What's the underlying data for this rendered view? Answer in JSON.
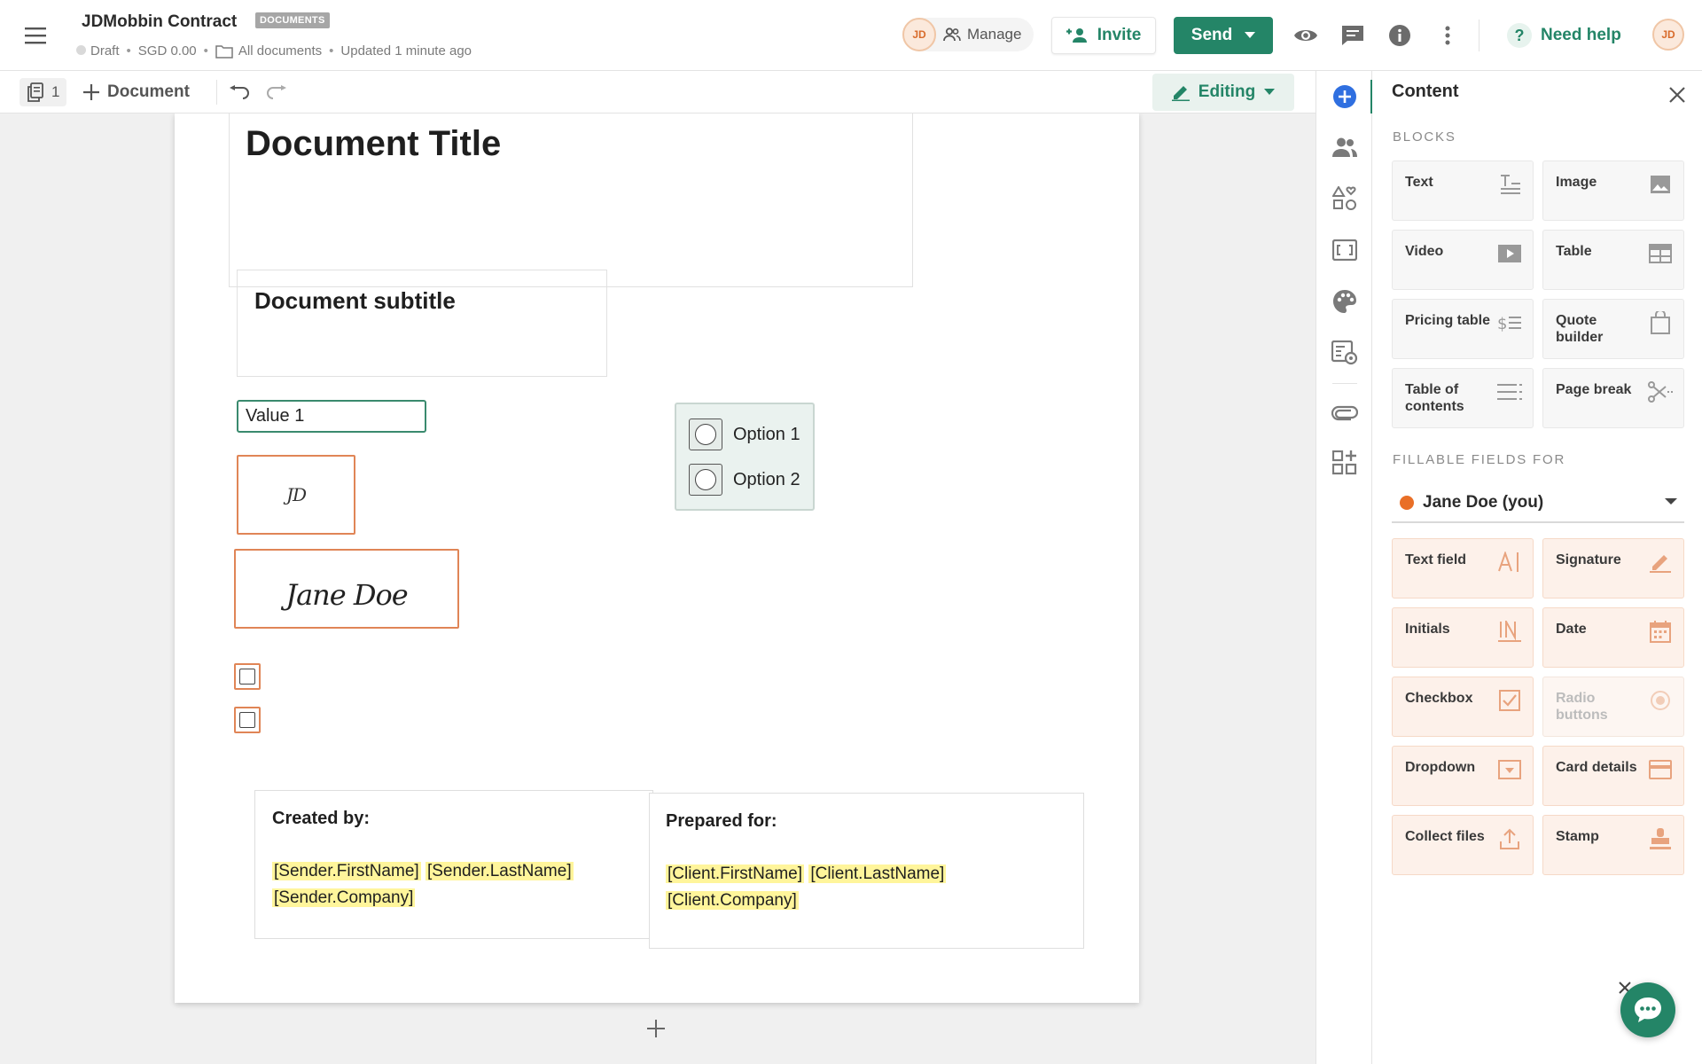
{
  "header": {
    "app_title": "JDMobbin Contract",
    "tag": "DOCUMENTS",
    "status": "Draft",
    "amount": "SGD 0.00",
    "folder": "All documents",
    "updated": "Updated 1 minute ago",
    "avatar_initials": "JD",
    "manage_label": "Manage",
    "invite_label": "Invite",
    "send_label": "Send",
    "help_label": "Need help",
    "help_symbol": "?",
    "user_initials": "JD",
    "accent_color": "#248567"
  },
  "toolbar": {
    "page_count": "1",
    "add_document_label": "Document",
    "mode_label": "Editing"
  },
  "document": {
    "title": "Document Title",
    "subtitle": "Document subtitle",
    "text_field_value": "Value 1",
    "initials": "JD",
    "signature": "Jane Doe",
    "radio_options": [
      "Option 1",
      "Option 2"
    ],
    "created_by": {
      "heading": "Created by:",
      "line1_a": "[Sender.FirstName]",
      "line1_b": "[Sender.LastName]",
      "line2": "[Sender.Company]"
    },
    "prepared_for": {
      "heading": "Prepared for:",
      "line1_a": "[Client.FirstName]",
      "line1_b": "[Client.LastName]",
      "line2": "[Client.Company]"
    }
  },
  "rail": {
    "items": [
      "add-icon",
      "recipients-icon",
      "shapes-icon",
      "variables-icon",
      "theme-icon",
      "settings-icon",
      "attachment-icon",
      "apps-icon"
    ]
  },
  "panel": {
    "title": "Content",
    "blocks_heading": "BLOCKS",
    "blocks": [
      {
        "label": "Text",
        "icon": "text-icon"
      },
      {
        "label": "Image",
        "icon": "image-icon"
      },
      {
        "label": "Video",
        "icon": "video-icon"
      },
      {
        "label": "Table",
        "icon": "table-icon"
      },
      {
        "label": "Pricing table",
        "icon": "pricing-table-icon"
      },
      {
        "label": "Quote builder",
        "icon": "quote-builder-icon"
      },
      {
        "label": "Table of contents",
        "icon": "table-of-contents-icon"
      },
      {
        "label": "Page break",
        "icon": "page-break-icon"
      }
    ],
    "fields_heading": "FILLABLE FIELDS FOR",
    "recipient": "Jane Doe (you)",
    "recipient_color": "#e96f27",
    "fields": [
      {
        "label": "Text field",
        "icon": "text-field-icon"
      },
      {
        "label": "Signature",
        "icon": "signature-icon"
      },
      {
        "label": "Initials",
        "icon": "initials-icon"
      },
      {
        "label": "Date",
        "icon": "date-icon"
      },
      {
        "label": "Checkbox",
        "icon": "checkbox-icon"
      },
      {
        "label": "Radio buttons",
        "icon": "radio-buttons-icon",
        "disabled": true
      },
      {
        "label": "Dropdown",
        "icon": "dropdown-icon"
      },
      {
        "label": "Card details",
        "icon": "card-details-icon"
      },
      {
        "label": "Collect files",
        "icon": "collect-files-icon"
      },
      {
        "label": "Stamp",
        "icon": "stamp-icon"
      }
    ]
  }
}
